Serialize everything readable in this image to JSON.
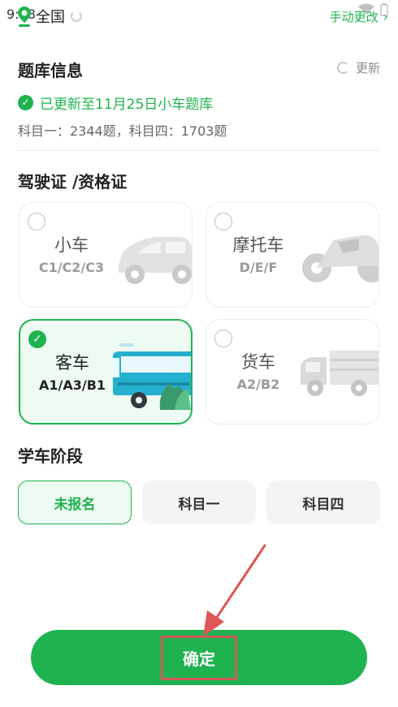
{
  "status_bar": {
    "time": "9:28"
  },
  "header": {
    "location": "全国",
    "manual_change": "手动更改",
    "manual_chevron": "›"
  },
  "bank_info": {
    "title": "题库信息",
    "refresh_label": "更新",
    "updated_text": "已更新至11月25日小车题库",
    "counts_text": "科目一：2344题，科目四：1703题"
  },
  "license": {
    "title": "驾驶证 /资格证",
    "cards": [
      {
        "name": "小车",
        "codes": "C1/C2/C3",
        "selected": false
      },
      {
        "name": "摩托车",
        "codes": "D/E/F",
        "selected": false
      },
      {
        "name": "客车",
        "codes": "A1/A3/B1",
        "selected": true
      },
      {
        "name": "货车",
        "codes": "A2/B2",
        "selected": false
      }
    ]
  },
  "stage": {
    "title": "学车阶段",
    "options": [
      {
        "label": "未报名",
        "active": true
      },
      {
        "label": "科目一",
        "active": false
      },
      {
        "label": "科目四",
        "active": false
      }
    ]
  },
  "confirm_label": "确定",
  "colors": {
    "accent": "#1fb34f",
    "annotation": "#e05555"
  }
}
